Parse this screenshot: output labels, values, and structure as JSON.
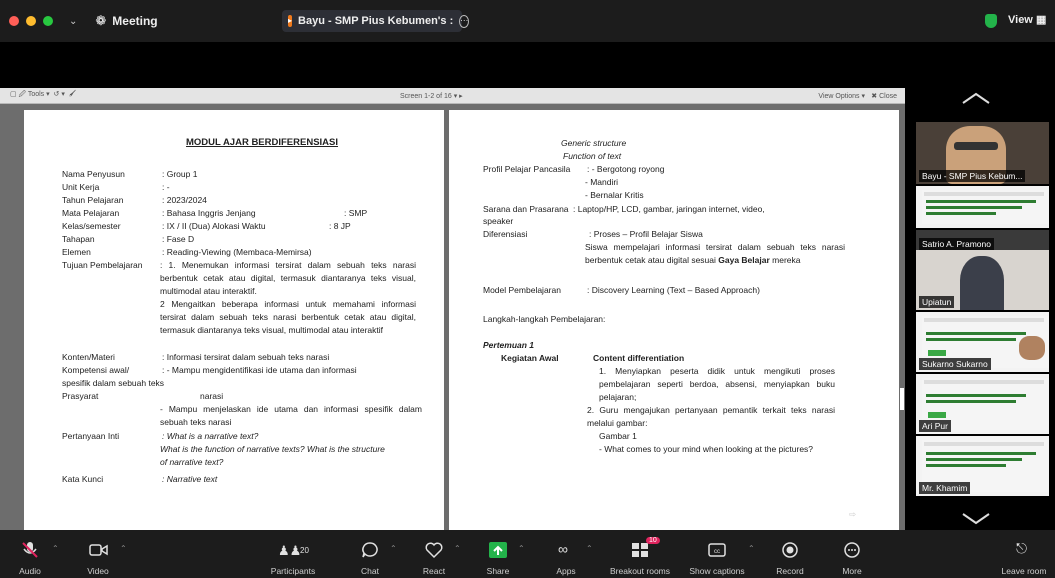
{
  "topbar": {
    "meeting_label": "Meeting",
    "share_title": "Bayu - SMP Pius Kebumen's :",
    "view_label": "View",
    "colors": {
      "close": "#ff5f57",
      "min": "#febc2e",
      "max": "#28c840",
      "shield": "#23b34a",
      "share_icon": "#f07a1c"
    }
  },
  "viewer": {
    "tools_label": "Tools",
    "screen_label": "Screen 1-2 of 16",
    "view_options_label": "View Options",
    "close_label": "Close"
  },
  "doc_left": {
    "title": "MODUL AJAR BERDIFERENSIASI",
    "fields": [
      {
        "label": "Nama Penyusun",
        "value": ": Group 1"
      },
      {
        "label": "Unit Kerja",
        "value": ": -"
      },
      {
        "label": "Tahun Pelajaran",
        "value": ": 2023/2024"
      },
      {
        "label": "Mata Pelajaran",
        "value": ": Bahasa Inggris Jenjang",
        "extra": ": SMP"
      },
      {
        "label": "Kelas/semester",
        "value": ": IX / II (Dua) Alokasi Waktu",
        "extra": ": 8 JP"
      },
      {
        "label": "Tahapan",
        "value": ": Fase D"
      },
      {
        "label": "Elemen",
        "value": ": Reading-Viewing (Membaca-Memirsa)"
      }
    ],
    "tujuan_label": "Tujuan Pembelajaran",
    "tujuan_1": ": 1. Menemukan informasi tersirat dalam sebuah teks narasi berbentuk cetak atau digital, termasuk diantaranya teks visual, multimodal atau interaktif.",
    "tujuan_2": "2 Mengaitkan beberapa informasi untuk memahami informasi tersirat dalam sebuah teks narasi berbentuk cetak atau digital, termasuk diantaranya teks visual, multimodal atau interaktif",
    "konten_label": "Konten/Materi",
    "konten_value": ": Informasi tersirat dalam sebuah teks narasi",
    "kompetensi_label": "Kompetensi awal/",
    "kompetensi_value": ": - Mampu mengidentifikasi ide utama dan informasi",
    "kompetensi_cont": "spesifik dalam sebuah teks",
    "prasyarat_label": "Prasyarat",
    "prasyarat_value": "narasi",
    "prasyarat_2": "- Mampu menjelaskan ide utama dan informasi spesifik dalam sebuah teks narasi",
    "pertanyaan_label": "Pertanyaan Inti",
    "pertanyaan_1": ": What is a narrative text?",
    "pertanyaan_2": "What is the function of narrative texts? What is the structure of narrative text?",
    "kata_label": "Kata Kunci",
    "kata_value": ": Narrative text"
  },
  "doc_right": {
    "generic": "Generic structure",
    "function": "Function of text",
    "profil_label": "Profil Pelajar Pancasila",
    "profil_1": ": - Bergotong royong",
    "profil_2": "- Mandiri",
    "profil_3": "- Bernalar Kritis",
    "sarana_label": "Sarana dan Prasarana",
    "sarana_value": ": Laptop/HP, LCD, gambar, jaringan internet, video,",
    "sarana_cont": "speaker",
    "diferensiasi_label": "Diferensiasi",
    "diferensiasi_value": ": Proses – Profil Belajar Siswa",
    "diferensiasi_para_start": "Siswa mempelajari informasi tersirat dalam sebuah teks narasi berbentuk cetak atau digital sesuai ",
    "diferensiasi_bold": "Gaya Belajar",
    "diferensiasi_end": " mereka",
    "model_label": "Model Pembelajaran",
    "model_value": ": Discovery Learning (Text – Based Approach)",
    "langkah": "Langkah-langkah Pembelajaran:",
    "pertemuan": "Pertemuan 1",
    "kegiatan": "Kegiatan Awal",
    "content_diff": "Content differentiation",
    "step_1": "1. Menyiapkan peserta didik untuk mengikuti proses pembelajaran seperti berdoa, absensi, menyiapkan buku pelajaran;",
    "step_2": "2. Guru mengajukan pertanyaan pemantik terkait teks narasi melalui gambar:",
    "gambar": "Gambar 1",
    "question": "- What comes to your mind when looking at the pictures?"
  },
  "participants_panel": {
    "tiles": [
      {
        "name": "Bayu - SMP Pius Kebum..."
      },
      {
        "name": ""
      },
      {
        "name": "Satrio A. Pramono"
      },
      {
        "name": "Upiatun"
      },
      {
        "name": "Sukarno Sukarno"
      },
      {
        "name": "Ari Pur"
      },
      {
        "name": "Mr. Khamim"
      }
    ]
  },
  "toolbar": {
    "audio": "Audio",
    "video": "Video",
    "participants": "Participants",
    "participants_count": "20",
    "chat": "Chat",
    "react": "React",
    "share": "Share",
    "apps": "Apps",
    "breakout": "Breakout rooms",
    "breakout_badge": "10",
    "captions": "Show captions",
    "record": "Record",
    "more": "More",
    "leave": "Leave room",
    "colors": {
      "share": "#23b34a",
      "badge": "#e0245e",
      "audio_muted": "#e0245e"
    }
  }
}
